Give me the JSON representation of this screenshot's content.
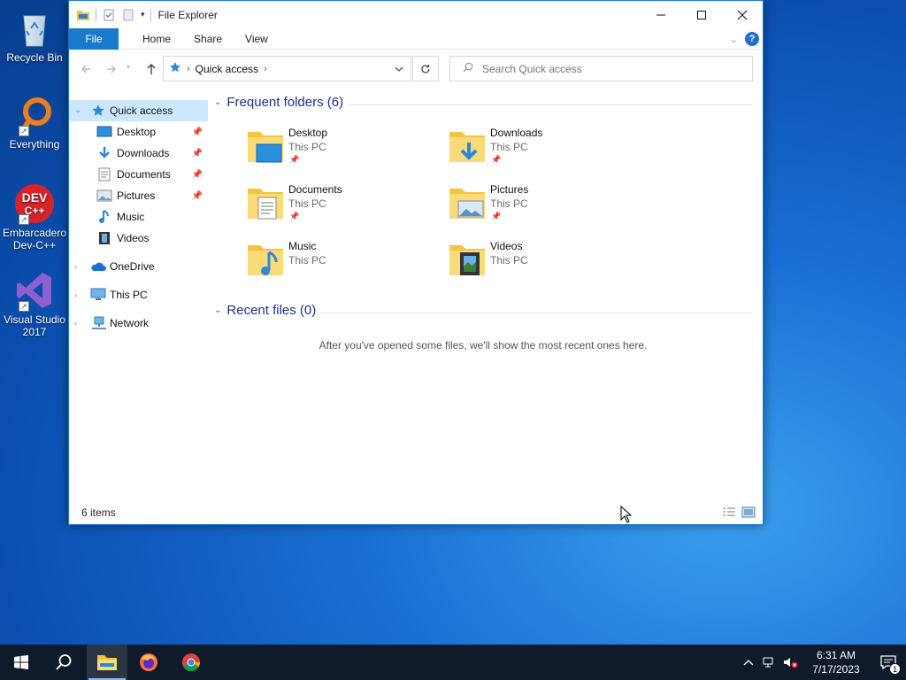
{
  "desktop": {
    "icons": [
      {
        "label": "Recycle Bin",
        "icon": "recycle-bin-icon"
      },
      {
        "label": "Everything",
        "icon": "everything-search-icon"
      },
      {
        "label": "Embarcadero Dev-C++",
        "icon": "devcpp-icon",
        "badge": "DEV C++"
      },
      {
        "label": "Visual Studio 2017",
        "icon": "visual-studio-icon"
      }
    ]
  },
  "window": {
    "title": "File Explorer",
    "ribbon_tabs": [
      "File",
      "Home",
      "Share",
      "View"
    ],
    "address": {
      "crumb": "Quick access"
    },
    "search_placeholder": "Search Quick access"
  },
  "navpane": {
    "quick_access": "Quick access",
    "pinned": [
      {
        "label": "Desktop",
        "pinned": true
      },
      {
        "label": "Downloads",
        "pinned": true
      },
      {
        "label": "Documents",
        "pinned": true
      },
      {
        "label": "Pictures",
        "pinned": true
      },
      {
        "label": "Music",
        "pinned": false
      },
      {
        "label": "Videos",
        "pinned": false
      }
    ],
    "roots": [
      "OneDrive",
      "This PC",
      "Network"
    ]
  },
  "content": {
    "frequent_header": "Frequent folders (6)",
    "folders": [
      {
        "name": "Desktop",
        "location": "This PC",
        "pinned": true
      },
      {
        "name": "Downloads",
        "location": "This PC",
        "pinned": true
      },
      {
        "name": "Documents",
        "location": "This PC",
        "pinned": true
      },
      {
        "name": "Pictures",
        "location": "This PC",
        "pinned": true
      },
      {
        "name": "Music",
        "location": "This PC",
        "pinned": false
      },
      {
        "name": "Videos",
        "location": "This PC",
        "pinned": false
      }
    ],
    "recent_header": "Recent files (0)",
    "recent_empty": "After you've opened some files, we'll show the most recent ones here."
  },
  "status": {
    "items": "6 items"
  },
  "taskbar": {
    "time": "6:31 AM",
    "date": "7/17/2023",
    "notification_count": "1"
  },
  "colors": {
    "accent": "#1979ca",
    "selection": "#cce8ff",
    "group_header": "#1e3287",
    "folder": "#f5c342",
    "taskbar": "#0f1a2a"
  }
}
